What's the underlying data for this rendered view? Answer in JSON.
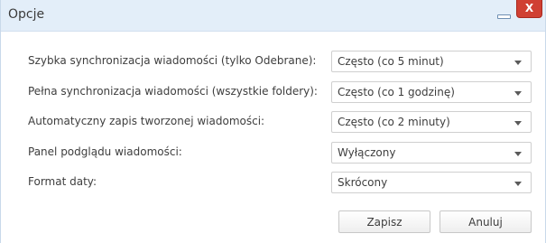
{
  "window": {
    "title": "Opcje",
    "close_label": "X"
  },
  "settings": [
    {
      "label": "Szybka synchronizacja wiadomości (tylko Odebrane):",
      "value": "Często (co 5 minut)"
    },
    {
      "label": "Pełna synchronizacja wiadomości (wszystkie foldery):",
      "value": "Często (co 1 godzinę)"
    },
    {
      "label": "Automatyczny zapis tworzonej wiadomości:",
      "value": "Często (co 2 minuty)"
    },
    {
      "label": "Panel podglądu wiadomości:",
      "value": "Wyłączony"
    },
    {
      "label": "Format daty:",
      "value": "Skrócony"
    }
  ],
  "buttons": {
    "save_label": "Zapisz",
    "cancel_label": "Anuluj"
  }
}
